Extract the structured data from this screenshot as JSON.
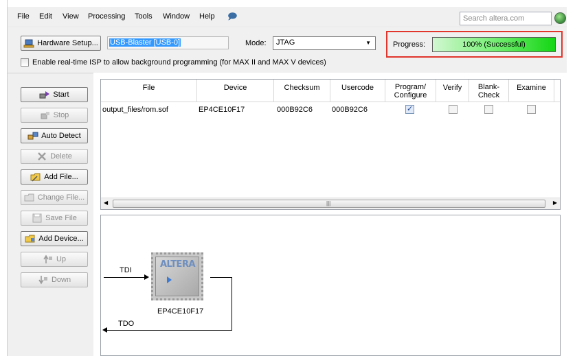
{
  "menu": [
    "File",
    "Edit",
    "View",
    "Processing",
    "Tools",
    "Window",
    "Help"
  ],
  "help_icon": "speech-bubble-icon",
  "search": {
    "placeholder": "Search altera.com",
    "icon": "globe-search-icon"
  },
  "hardware": {
    "button_label": "Hardware Setup...",
    "value": "USB-Blaster [USB-0]"
  },
  "mode": {
    "label": "Mode:",
    "value": "JTAG"
  },
  "progress": {
    "label": "Progress:",
    "text": "100% (Successful)",
    "percent": 100,
    "accent": "#e0362c",
    "bar_color": "#14d614"
  },
  "background_programming": {
    "label": "Enable real-time ISP to allow background programming (for MAX II and MAX V devices)",
    "checked": false
  },
  "side_buttons": [
    {
      "label": "Start",
      "icon": "start-icon",
      "enabled": true
    },
    {
      "label": "Stop",
      "icon": "stop-icon",
      "enabled": false
    },
    {
      "label": "Auto Detect",
      "icon": "auto-detect-icon",
      "enabled": true
    },
    {
      "label": "Delete",
      "icon": "delete-icon",
      "enabled": false
    },
    {
      "label": "Add File...",
      "icon": "add-file-icon",
      "enabled": true
    },
    {
      "label": "Change File...",
      "icon": "change-file-icon",
      "enabled": false
    },
    {
      "label": "Save File",
      "icon": "save-file-icon",
      "enabled": false
    },
    {
      "label": "Add Device...",
      "icon": "add-device-icon",
      "enabled": true
    },
    {
      "label": "Up",
      "icon": "up-icon",
      "enabled": false
    },
    {
      "label": "Down",
      "icon": "down-icon",
      "enabled": false
    }
  ],
  "table": {
    "columns": [
      "File",
      "Device",
      "Checksum",
      "Usercode",
      "Program/\nConfigure",
      "Verify",
      "Blank-\nCheck",
      "Examine"
    ],
    "rows": [
      {
        "file": "output_files/rom.sof",
        "device": "EP4CE10F17",
        "checksum": "000B92C6",
        "usercode": "000B92C6",
        "program": true,
        "verify": false,
        "blank_check": false,
        "examine": false
      }
    ]
  },
  "chain": {
    "tdi": "TDI",
    "tdo": "TDO",
    "logo": "ALTERA",
    "device": "EP4CE10F17"
  }
}
